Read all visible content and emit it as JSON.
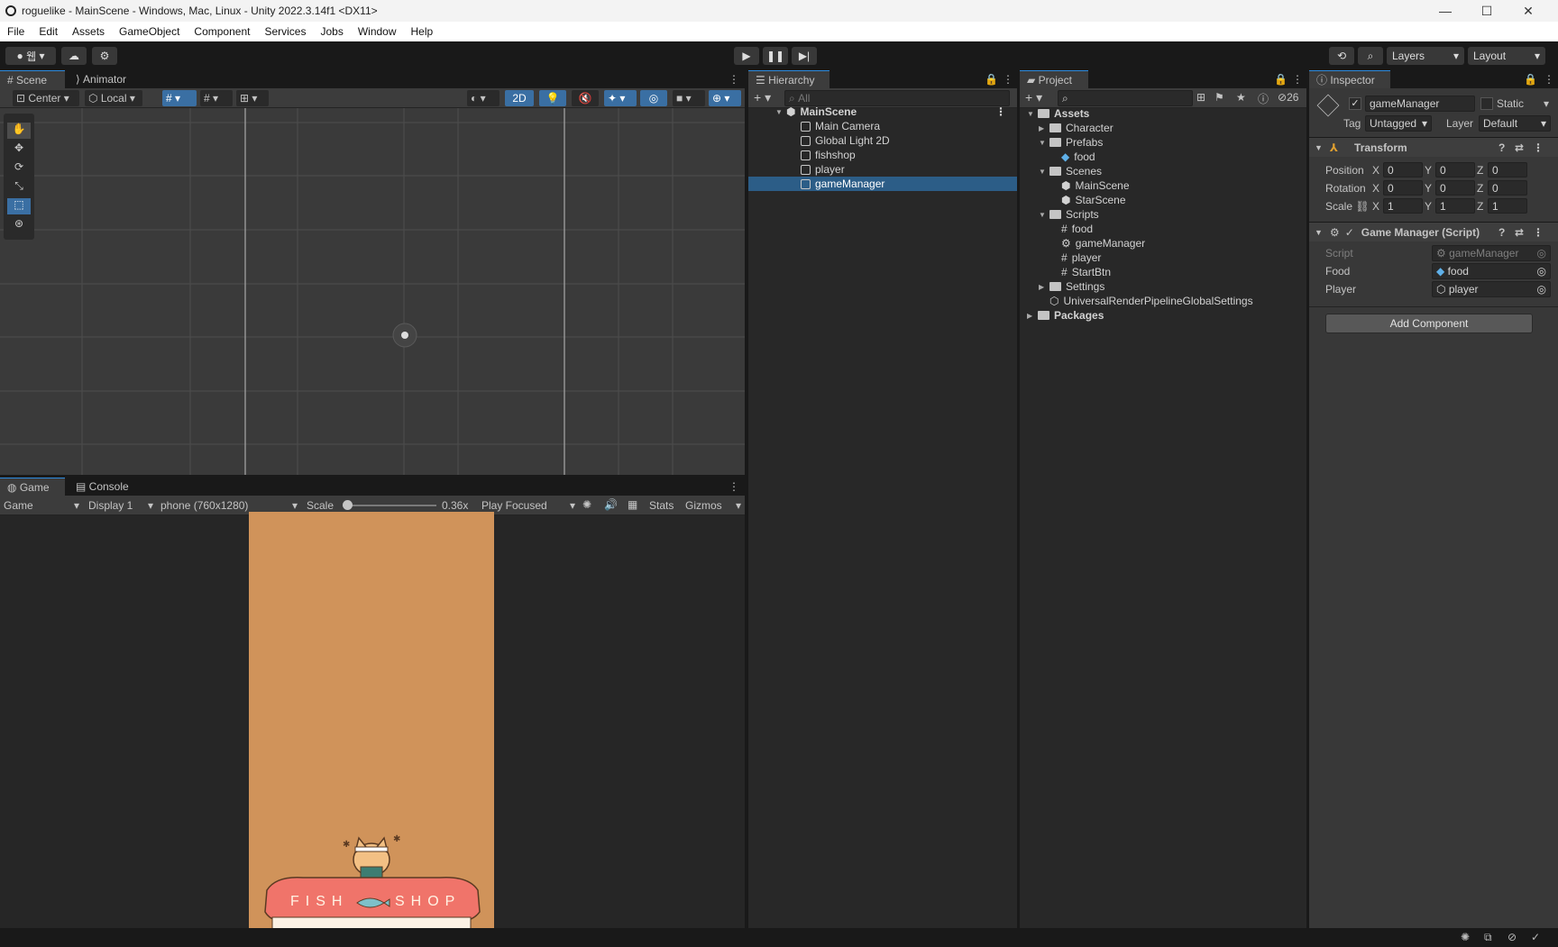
{
  "window": {
    "title": "roguelike - MainScene - Windows, Mac, Linux - Unity 2022.3.14f1 <DX11>"
  },
  "menu": [
    "File",
    "Edit",
    "Assets",
    "GameObject",
    "Component",
    "Services",
    "Jobs",
    "Window",
    "Help"
  ],
  "toolbar": {
    "account_label": "웹",
    "layers_label": "Layers",
    "layout_label": "Layout"
  },
  "scene": {
    "tabs": [
      "Scene",
      "Animator"
    ],
    "pivot_label": "Center",
    "space_label": "Local",
    "mode_2d_label": "2D"
  },
  "game": {
    "tabs": [
      "Game",
      "Console"
    ],
    "view_label": "Game",
    "display_label": "Display 1",
    "resolution_label": "phone (760x1280)",
    "scale_label": "Scale",
    "scale_value": "0.36x",
    "play_mode_label": "Play Focused",
    "stats_label": "Stats",
    "gizmos_label": "Gizmos",
    "sign_left": "FISH",
    "sign_right": "SHOP"
  },
  "hierarchy": {
    "tab": "Hierarchy",
    "search_placeholder": "All",
    "scene_name": "MainScene",
    "items": [
      "Main Camera",
      "Global Light 2D",
      "fishshop",
      "player",
      "gameManager"
    ]
  },
  "project": {
    "tab": "Project",
    "badge": "26",
    "tree": [
      {
        "label": "Assets",
        "level": 0,
        "bold": true
      },
      {
        "label": "Character",
        "level": 1
      },
      {
        "label": "Prefabs",
        "level": 1
      },
      {
        "label": "food",
        "level": 2
      },
      {
        "label": "Scenes",
        "level": 1
      },
      {
        "label": "MainScene",
        "level": 2
      },
      {
        "label": "StarScene",
        "level": 2
      },
      {
        "label": "Scripts",
        "level": 1
      },
      {
        "label": "food",
        "level": 2
      },
      {
        "label": "gameManager",
        "level": 2
      },
      {
        "label": "player",
        "level": 2
      },
      {
        "label": "StartBtn",
        "level": 2
      },
      {
        "label": "Settings",
        "level": 1
      },
      {
        "label": "UniversalRenderPipelineGlobalSettings",
        "level": 1
      },
      {
        "label": "Packages",
        "level": 0,
        "bold": true
      }
    ]
  },
  "inspector": {
    "tab": "Inspector",
    "object_name": "gameManager",
    "static_label": "Static",
    "tag_label": "Tag",
    "tag_value": "Untagged",
    "layer_label": "Layer",
    "layer_value": "Default",
    "transform": {
      "title": "Transform",
      "position_label": "Position",
      "rotation_label": "Rotation",
      "scale_label": "Scale",
      "position": [
        "0",
        "0",
        "0"
      ],
      "rotation": [
        "0",
        "0",
        "0"
      ],
      "scale": [
        "1",
        "1",
        "1"
      ]
    },
    "script": {
      "title": "Game Manager (Script)",
      "script_label": "Script",
      "script_value": "gameManager",
      "food_label": "Food",
      "food_value": "food",
      "player_label": "Player",
      "player_value": "player"
    },
    "add_component_label": "Add Component"
  }
}
